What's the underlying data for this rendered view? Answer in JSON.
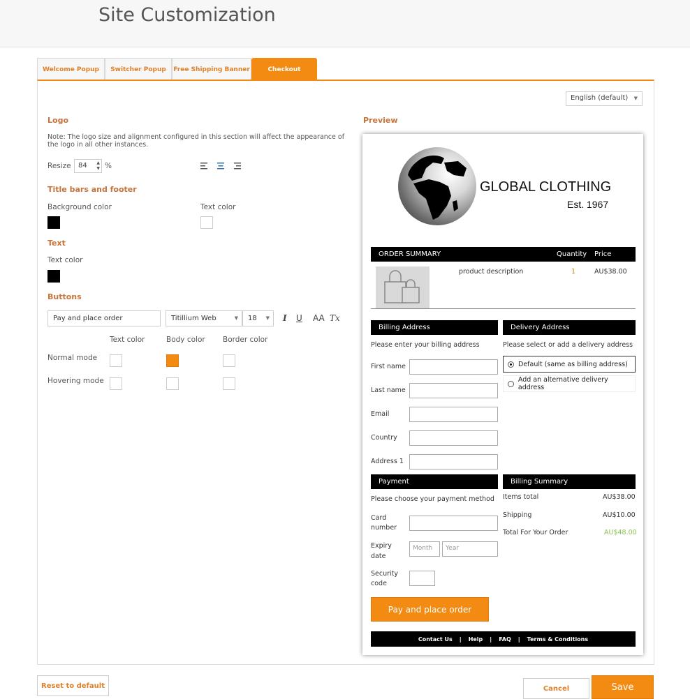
{
  "page_title": "Site Customization",
  "tabs": [
    {
      "label": "Welcome Popup",
      "active": false
    },
    {
      "label": "Switcher Popup",
      "active": false
    },
    {
      "label": "Free Shipping Banner",
      "active": false
    },
    {
      "label": "Checkout",
      "active": true
    }
  ],
  "language_select": "English (default)",
  "logo": {
    "heading": "Logo",
    "note": "Note: The logo size and alignment configured in this section will affect the appearance of the logo in all other instances.",
    "resize_label": "Resize",
    "resize_value": "84",
    "resize_unit": "%"
  },
  "title_bars": {
    "heading": "Title bars and footer",
    "background_color_label": "Background color",
    "text_color_label": "Text color",
    "background_color": "#000000",
    "text_color": "#ffffff"
  },
  "text_section": {
    "heading": "Text",
    "text_color_label": "Text color",
    "text_color": "#000000"
  },
  "buttons": {
    "heading": "Buttons",
    "label_value": "Pay and place order",
    "font_family": "Titillium Web",
    "font_size": "18",
    "italic": "I",
    "underline": "U",
    "case": "AA",
    "clear_format": "Tx",
    "col_text_color": "Text color",
    "col_body_color": "Body color",
    "col_border_color": "Border color",
    "normal_mode": "Normal mode",
    "hovering_mode": "Hovering mode",
    "normal_body_color": "#f38a12"
  },
  "preview": {
    "heading": "Preview",
    "brand_name": "GLOBAL CLOTHING",
    "brand_est": "Est. 1967",
    "order_summary": {
      "title": "ORDER SUMMARY",
      "quantity_label": "Quantity",
      "price_label": "Price",
      "product_description": "product description",
      "quantity": "1",
      "price": "AU$38.00"
    },
    "billing_address": {
      "title": "Billing Address",
      "prompt": "Please enter your billing address",
      "fields": [
        "First name",
        "Last name",
        "Email",
        "Country",
        "Address 1"
      ]
    },
    "delivery_address": {
      "title": "Delivery Address",
      "prompt": "Please select or add a delivery address",
      "option_default": "Default (same as billing address)",
      "option_alternative": "Add an alternative delivery address"
    },
    "payment": {
      "title": "Payment",
      "prompt": "Please choose your payment method",
      "card_number_label_1": "Card",
      "card_number_label_2": "number",
      "expiry_label_1": "Expiry",
      "expiry_label_2": "date",
      "month_placeholder": "Month",
      "year_placeholder": "Year",
      "security_label_1": "Security",
      "security_label_2": "code"
    },
    "billing_summary": {
      "title": "Billing Summary",
      "items_total_label": "Items total",
      "items_total": "AU$38.00",
      "shipping_label": "Shipping",
      "shipping": "AU$10.00",
      "total_label": "Total For Your Order",
      "total": "AU$48.00"
    },
    "pay_button": "Pay and place order",
    "footer_links": [
      "Contact Us",
      "|",
      "Help",
      "|",
      "FAQ",
      "|",
      "Terms & Conditions"
    ]
  },
  "actions": {
    "reset": "Reset to default",
    "cancel": "Cancel",
    "save": "Save"
  }
}
